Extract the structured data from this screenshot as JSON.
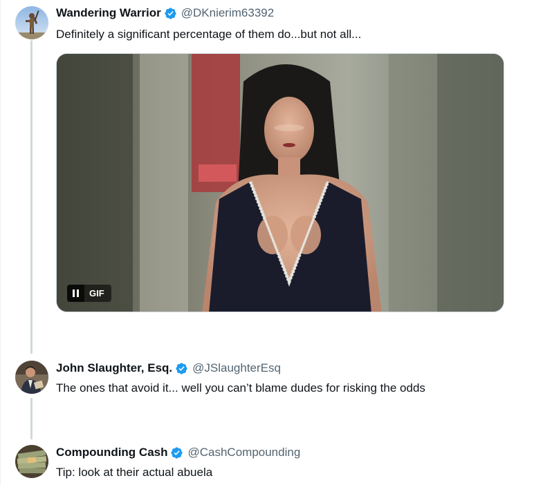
{
  "tweets": [
    {
      "display_name": "Wandering Warrior",
      "handle": "@DKnierim63392",
      "text": "Definitely a significant percentage of them do...but not all...",
      "avatar_icon": "warrior-avatar",
      "verified": true
    },
    {
      "display_name": "John Slaughter, Esq.",
      "handle": "@JSlaughterEsq",
      "text": "The ones that avoid it... well you can’t blame dudes for risking the odds",
      "avatar_icon": "man-avatar",
      "verified": true
    },
    {
      "display_name": "Compounding Cash",
      "handle": "@CashCompounding",
      "text": "Tip: look at their actual abuela",
      "avatar_icon": "cash-stack-avatar",
      "verified": true
    }
  ],
  "media": {
    "gif_label": "GIF",
    "pause_icon": "pause-icon",
    "type": "animated-gif"
  },
  "colors": {
    "verified": "#1d9bf0",
    "handle": "#536471",
    "thread_line": "#cfd9de",
    "text": "#0f1419"
  }
}
